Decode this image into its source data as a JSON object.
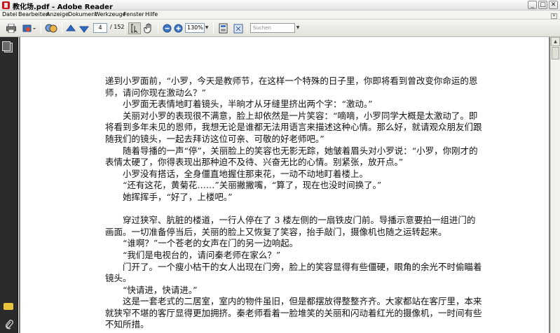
{
  "window": {
    "title": "教化场.pdf - Adobe Reader",
    "min_glyph": "_",
    "max_glyph": "□",
    "close_glyph": "✕"
  },
  "menu": {
    "items": [
      "Datei",
      "Bearbeiten",
      "Anzeige",
      "Dokument",
      "Werkzeuge",
      "Fenster",
      "Hilfe"
    ],
    "close_glyph": "✕"
  },
  "toolbar": {
    "current_page": "4",
    "total_pages": "/ 152",
    "zoom": "130%",
    "search_placeholder": "Suchen",
    "dropdown_glyph": "▼"
  },
  "document": {
    "paragraphs": [
      {
        "indent": false,
        "text": "递到小罗面前，“小罗，今天是教师节，在这样一个特殊的日子里，你即将看到曾改变你命运的恩师，请问你现在激动么？”"
      },
      {
        "indent": true,
        "text": "小罗面无表情地盯着镜头，半晌才从牙缝里挤出两个字：“激动。”"
      },
      {
        "indent": true,
        "text": "关丽对小罗的表现很不满意，脸上却依然是一片笑容：“嘀嘀，小罗同学大概是太激动了。即将看到多年未见的恩师，我想无论是谁都无法用语言来描述这种心情。那么好，就请观众朋友们跟随我们的镜头，一起去拜访这位可亲、可敬的好老师吧。”"
      },
      {
        "indent": true,
        "text": "随着导播的一声“停”，关丽脸上的笑容也无影无踪，她皱着眉头对小罗说：“小罗，你刚才的表情太硬了，你得表现出那种迫不及待、兴奋无比的心情。别紧张，放开点。”"
      },
      {
        "indent": true,
        "text": "小罗没有搭话，全身僵直地握住那束花，一动不动地盯着楼上。"
      },
      {
        "indent": true,
        "text": "“还有这花，黄菊花……”关丽撇撇嘴，“算了，现在也没时间换了。”"
      },
      {
        "indent": true,
        "text": "她挥挥手，“好了，上楼吧。”"
      },
      {
        "indent": true,
        "gap": true,
        "text": ""
      },
      {
        "indent": true,
        "text": "穿过狭窄、肮脏的楼道，一行人停在了 3 楼左侧的一扇铁皮门前。导播示意要拍一组进门的画面。一切准备停当后，关丽的脸上又恢复了笑容，抬手敲门，摄像机也随之运转起来。"
      },
      {
        "indent": true,
        "text": "“谁啊？”一个苍老的女声在门的另一边响起。"
      },
      {
        "indent": true,
        "text": "“我们是电视台的，请问秦老师在家么？”"
      },
      {
        "indent": true,
        "text": "门开了。一个瘦小枯干的女人出现在门旁，脸上的笑容显得有些僵硬，眼角的余光不时偷瞄着镜头。"
      },
      {
        "indent": true,
        "text": "“快请进，快请进。”"
      },
      {
        "indent": true,
        "text": "这是一套老式的二居室，室内的物件虽旧，但是都摆放得整整齐齐。大家都站在客厅里，本来就狭窄不堪的客厅显得更加拥挤。秦老师看着一脸堆笑的关丽和闪动着红光的摄像机，一时间有些不知所措。"
      }
    ]
  }
}
